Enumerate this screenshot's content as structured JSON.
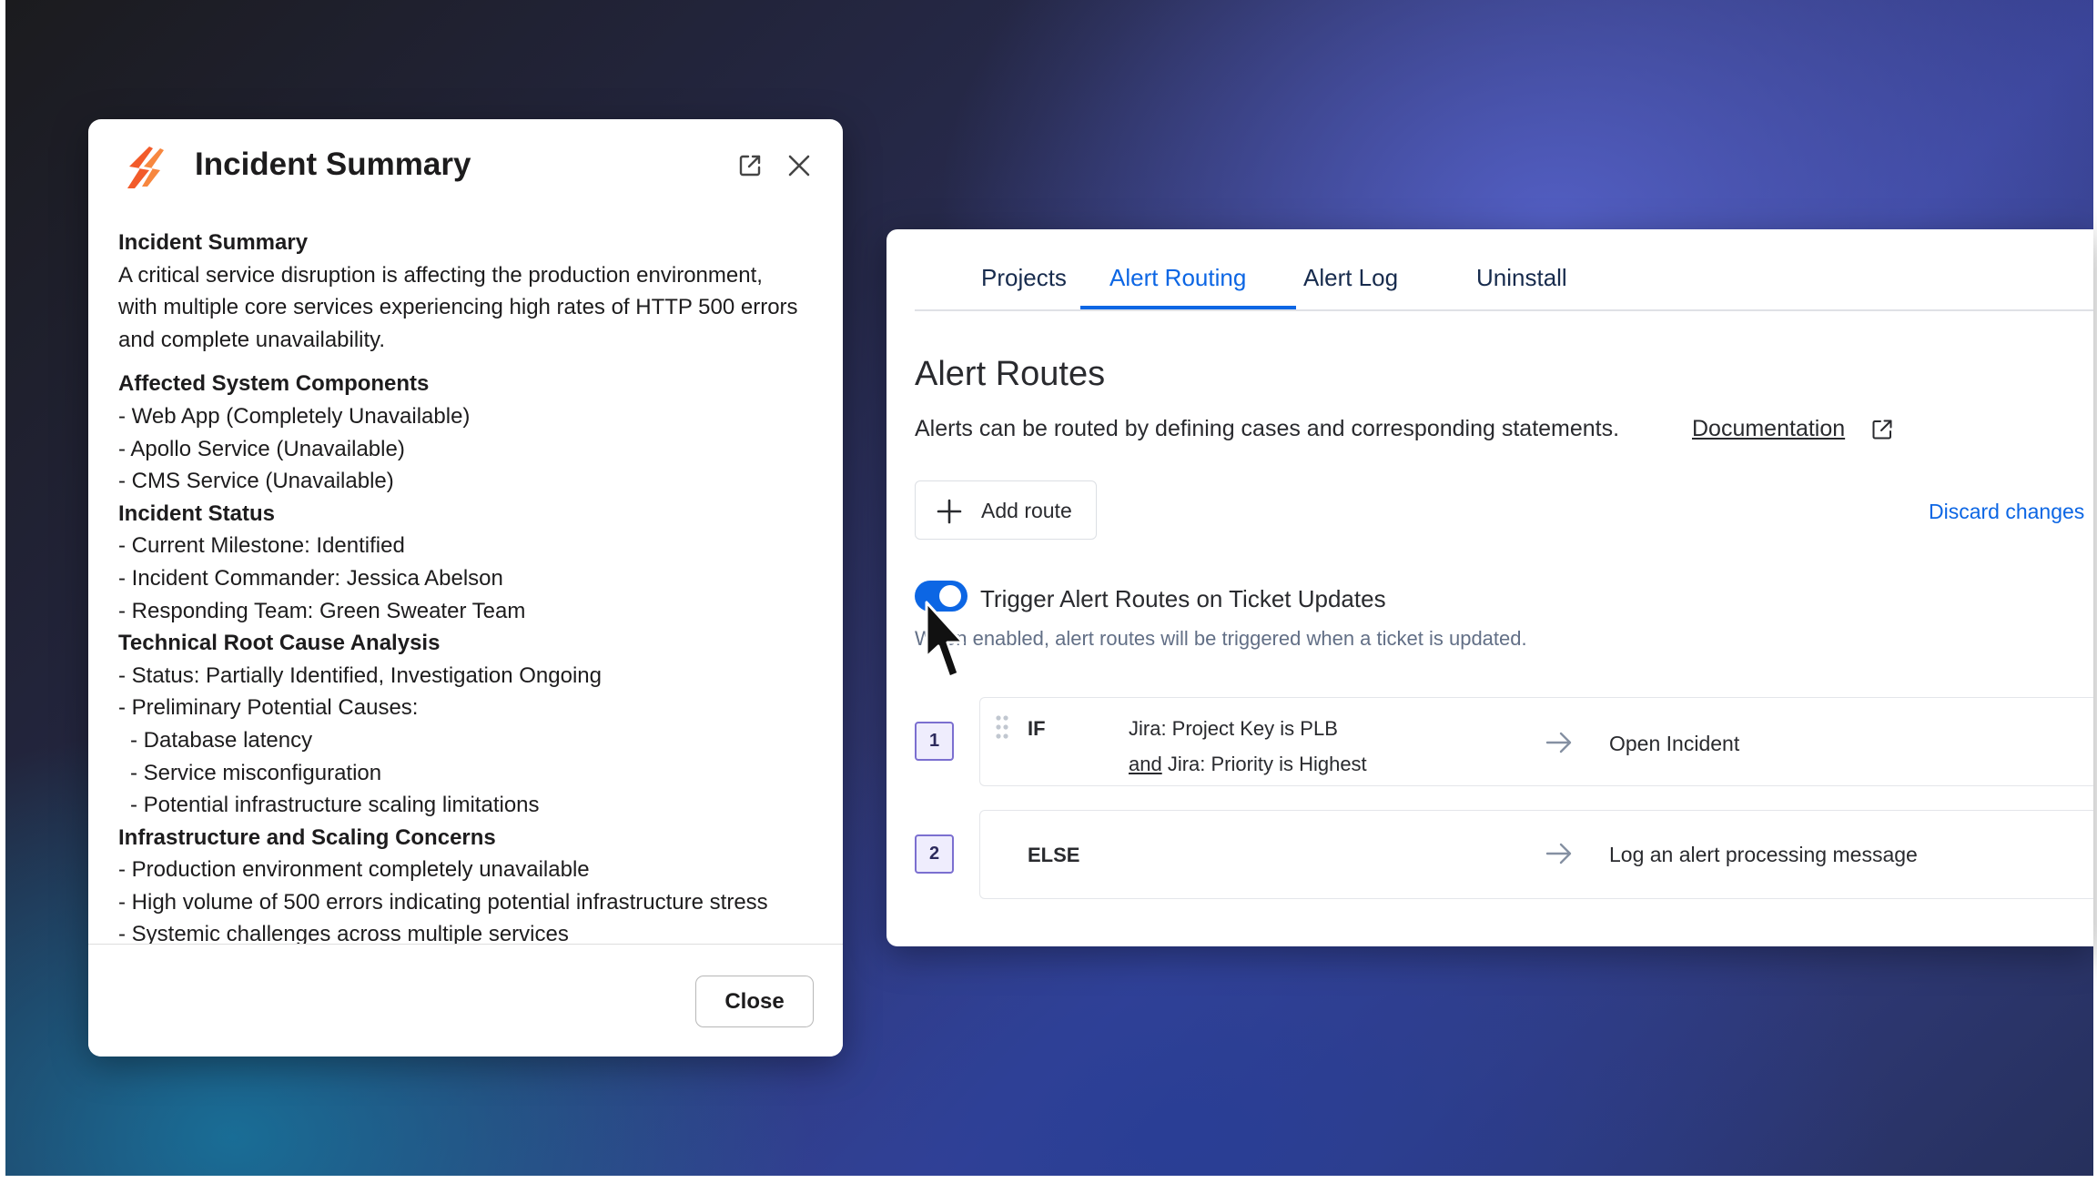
{
  "modal": {
    "title": "Incident Summary",
    "close_button": "Close",
    "summary": {
      "heading": "Incident Summary",
      "paragraph_lines": [
        "A critical service disruption is affecting the production environment,",
        "with multiple core services experiencing high rates of HTTP 500 errors",
        "and complete unavailability."
      ]
    },
    "components": {
      "heading": "Affected System Components",
      "items": [
        "- Web App (Completely Unavailable)",
        "- Apollo Service (Unavailable)",
        "- CMS Service (Unavailable)"
      ]
    },
    "status": {
      "heading": "Incident Status",
      "items": [
        "- Current Milestone: Identified",
        "- Incident Commander: Jessica Abelson",
        "- Responding Team: Green Sweater Team"
      ]
    },
    "root_cause": {
      "heading": "Technical Root Cause Analysis",
      "items": [
        "- Status: Partially Identified, Investigation Ongoing",
        "- Preliminary Potential Causes:"
      ],
      "sub_items": [
        "- Database latency",
        "- Service misconfiguration",
        "- Potential infrastructure scaling limitations"
      ]
    },
    "scaling": {
      "heading": "Infrastructure and Scaling Concerns",
      "items": [
        "- Production environment completely unavailable",
        "- High volume of 500 errors indicating potential infrastructure stress",
        "- Systemic challenges across multiple services"
      ]
    }
  },
  "panel": {
    "tabs": [
      "Projects",
      "Alert Routing",
      "Alert Log",
      "Uninstall"
    ],
    "title": "Alert Routes",
    "description": "Alerts can be routed by defining cases and corresponding statements.",
    "documentation_link": "Documentation",
    "add_route": "Add route",
    "discard_changes": "Discard changes",
    "toggle_label": "Trigger Alert Routes on Ticket Updates",
    "toggle_help": "When enabled, alert routes will be triggered when a ticket is updated.",
    "routes": [
      {
        "number": "1",
        "keyword": "IF",
        "condition_1": "Jira: Project Key is PLB",
        "condition_and": "and",
        "condition_2": " Jira: Priority is Highest",
        "action": "Open Incident"
      },
      {
        "number": "2",
        "keyword": "ELSE",
        "action": "Log an alert processing message"
      }
    ]
  },
  "colors": {
    "accent_blue": "#0c66e4",
    "logo_orange": "#f25b2a",
    "route_badge_border": "#7b6fd0"
  },
  "icons": [
    "app-logo-icon",
    "open-external-icon",
    "close-icon",
    "plus-icon",
    "external-link-icon",
    "drag-handle-icon",
    "arrow-right-icon",
    "mouse-cursor-icon"
  ]
}
